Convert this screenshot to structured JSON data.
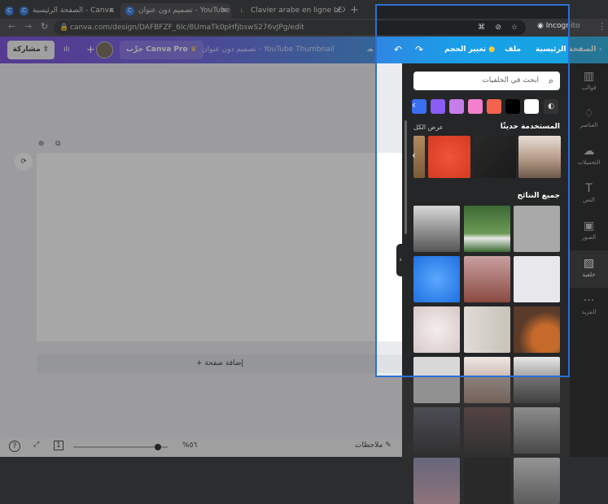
{
  "browser": {
    "tabs": [
      {
        "title": "الصفحة الرئيسية - Canva"
      },
      {
        "title": "تصميم دون عنوان - YouTube Thumbnail"
      },
      {
        "title": "Clavier arabe en ligne LEXILOGOS"
      }
    ],
    "url": "canva.com/design/DAFBFZF_6lc/8UmaTk0pHfjbswS276vJPg/edit",
    "profile": "Incognito"
  },
  "header": {
    "home": "الصفحة الرئيسية",
    "file": "ملف",
    "resize": "تغيير الحجم",
    "doc_title": "تصميم دون عنوان - YouTube Thumbnail",
    "try_pro": "جرِّب Canva Pro",
    "share": "مشاركة"
  },
  "panel": {
    "search_placeholder": "ابحث في الخلفيات",
    "colors": [
      "#ffffff",
      "#000000",
      "#f4634f",
      "#f37fce",
      "#c77de9",
      "#8b5cf6",
      "#3b6ff0"
    ],
    "recent_title": "المستخدمة حديثًا",
    "see_all": "عرض الكل",
    "all_results": "جميع النتائج"
  },
  "nav": [
    {
      "label": "قوالب",
      "icon": "▥"
    },
    {
      "label": "العناصر",
      "icon": "♢"
    },
    {
      "label": "التحميلات",
      "icon": "☁"
    },
    {
      "label": "النص",
      "icon": "T"
    },
    {
      "label": "الصور",
      "icon": "▣"
    },
    {
      "label": "خلفية",
      "icon": "▨"
    },
    {
      "label": "المزيد",
      "icon": "···"
    }
  ],
  "editor": {
    "add_page": "+ إضافة صفحة"
  },
  "bottom": {
    "notes": "ملاحظات",
    "zoom": "%٥٦",
    "page": "1",
    "zoom_fraction": 0.95
  }
}
